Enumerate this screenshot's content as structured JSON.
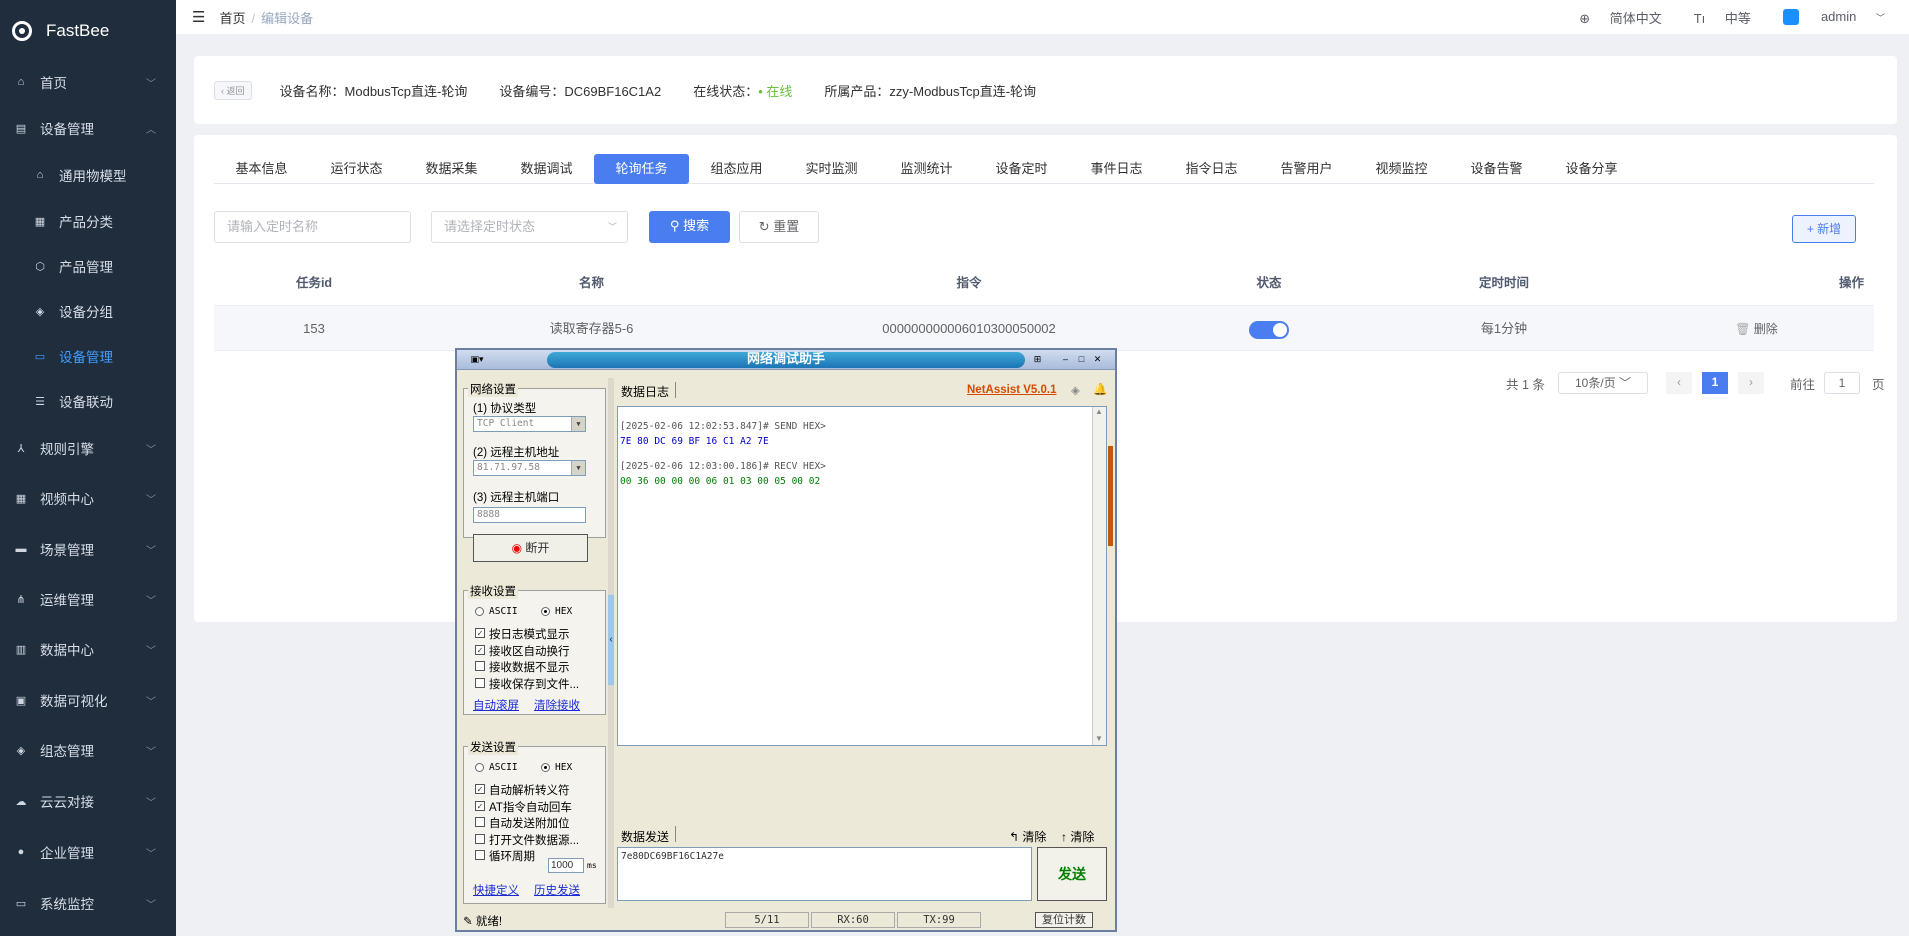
{
  "app": {
    "name": "FastBee"
  },
  "sidebar": {
    "items": [
      {
        "label": "首页",
        "icon": "home-icon"
      },
      {
        "label": "设备管理",
        "icon": "device-icon",
        "expanded": true
      },
      {
        "label": "通用物模型",
        "icon": "model-icon",
        "sub": true
      },
      {
        "label": "产品分类",
        "icon": "category-icon",
        "sub": true
      },
      {
        "label": "产品管理",
        "icon": "product-icon",
        "sub": true
      },
      {
        "label": "设备分组",
        "icon": "group-icon",
        "sub": true
      },
      {
        "label": "设备管理",
        "icon": "device-manage-icon",
        "sub": true,
        "active": true
      },
      {
        "label": "设备联动",
        "icon": "linkage-icon",
        "sub": true
      },
      {
        "label": "规则引擎",
        "icon": "rule-icon"
      },
      {
        "label": "视频中心",
        "icon": "video-icon"
      },
      {
        "label": "场景管理",
        "icon": "scene-icon"
      },
      {
        "label": "运维管理",
        "icon": "ops-icon"
      },
      {
        "label": "数据中心",
        "icon": "data-icon"
      },
      {
        "label": "数据可视化",
        "icon": "visual-icon"
      },
      {
        "label": "组态管理",
        "icon": "config-icon"
      },
      {
        "label": "云云对接",
        "icon": "cloud-icon"
      },
      {
        "label": "企业管理",
        "icon": "enterprise-icon"
      },
      {
        "label": "系统监控",
        "icon": "monitor-icon"
      }
    ]
  },
  "header": {
    "breadcrumb_home": "首页",
    "breadcrumb_sep": "/",
    "breadcrumb_current": "编辑设备",
    "lang": "简体中文",
    "size": "中等",
    "user": "admin"
  },
  "device": {
    "back": "返回",
    "name_label": "设备名称：",
    "name": "ModbusTcp直连-轮询",
    "sn_label": "设备编号：",
    "sn": "DC69BF16C1A2",
    "status_label": "在线状态：",
    "status": "在线",
    "product_label": "所属产品：",
    "product": "zzy-ModbusTcp直连-轮询",
    "status_color": "#67c23a"
  },
  "tabs": [
    "基本信息",
    "运行状态",
    "数据采集",
    "数据调试",
    "轮询任务",
    "组态应用",
    "实时监测",
    "监测统计",
    "设备定时",
    "事件日志",
    "指令日志",
    "告警用户",
    "视频监控",
    "设备告警",
    "设备分享"
  ],
  "active_tab": "轮询任务",
  "filters": {
    "name_placeholder": "请输入定时名称",
    "status_placeholder": "请选择定时状态",
    "search": "搜索",
    "reset": "重置",
    "add": "新增"
  },
  "table": {
    "headers": [
      "任务id",
      "名称",
      "指令",
      "状态",
      "定时时间",
      "操作"
    ],
    "rows": [
      {
        "id": "153",
        "name": "读取寄存器5-6",
        "command": "00000000000601030005000 2",
        "enabled": true,
        "schedule": "每1分钟",
        "action": "删除"
      }
    ]
  },
  "pagination": {
    "total": "共 1 条",
    "page_size": "10条/页",
    "current": "1",
    "goto": "前往",
    "page_value": "1",
    "page_unit": "页"
  },
  "netassist": {
    "title": "网络调试助手",
    "brand": "NetAssist V5.0.1",
    "net_group": "网络设置",
    "protocol_label": "(1) 协议类型",
    "protocol": "TCP Client",
    "host_label": "(2) 远程主机地址",
    "host": "81.71.97.58",
    "port_label": "(3) 远程主机端口",
    "port": "8888",
    "connect": "断开",
    "recv_group": "接收设置",
    "ascii": "ASCII",
    "hex": "HEX",
    "recv_opts": [
      "按日志模式显示",
      "接收区自动换行",
      "接收数据不显示",
      "接收保存到文件..."
    ],
    "recv_checked": [
      true,
      true,
      false,
      false
    ],
    "auto_scroll": "自动滚屏",
    "clear_recv": "清除接收",
    "send_group": "发送设置",
    "send_opts": [
      "自动解析转义符",
      "AT指令自动回车",
      "自动发送附加位",
      "打开文件数据源...",
      "循环周期"
    ],
    "send_checked": [
      true,
      true,
      false,
      false,
      false
    ],
    "period": "1000",
    "period_unit": "ms",
    "shortcut": "快捷定义",
    "history": "历史发送",
    "log_tab": "数据日志",
    "log": [
      {
        "head": "[2025-02-06 12:02:53.847]# SEND HEX>",
        "data": "7E 80 DC 69 BF 16 C1 A2 7E",
        "color": "#0000cc"
      },
      {
        "head": "[2025-02-06 12:03:00.186]# RECV HEX>",
        "data": "00 36 00 00 00 06 01 03 00 05 00 02",
        "color": "#008000"
      }
    ],
    "send_tab": "数据发送",
    "clear1": "清除",
    "clear2": "清除",
    "send_text": "7e80DC69BF16C1A27e",
    "send": "发送",
    "status": "就绪!",
    "counter": "5/11",
    "rx": "RX:60",
    "tx": "TX:99",
    "reset_count": "复位计数"
  }
}
